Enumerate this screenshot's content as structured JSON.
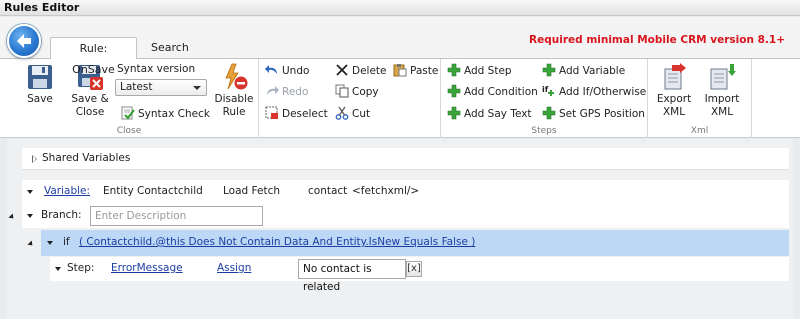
{
  "window": {
    "title": "Rules Editor"
  },
  "tabs": [
    {
      "label": "Rule: OnSave",
      "active": true
    },
    {
      "label": "Search",
      "active": false
    }
  ],
  "notice": {
    "text": "Required minimal Mobile CRM version 8.1+",
    "color": "#d8141c"
  },
  "ribbon": {
    "close_group": {
      "label": "Close",
      "save": "Save",
      "save_close_line1": "Save &",
      "save_close_line2": "Close",
      "syntax_version_label": "Syntax version",
      "syntax_version_value": "Latest",
      "syntax_check": "Syntax Check",
      "disable_rule_line1": "Disable",
      "disable_rule_line2": "Rule"
    },
    "edit_group": {
      "undo": "Undo",
      "redo": "Redo",
      "deselect": "Deselect",
      "delete": "Delete",
      "copy": "Copy",
      "cut": "Cut",
      "paste": "Paste"
    },
    "steps_group": {
      "label": "Steps",
      "add_step": "Add Step",
      "add_condition": "Add Condition",
      "add_say_text": "Add Say Text",
      "add_variable": "Add Variable",
      "add_if_otherwise": "Add If/Otherwise",
      "set_gps_position": "Set GPS Position"
    },
    "xml_group": {
      "label": "Xml",
      "export_line1": "Export",
      "export_line2": "XML",
      "import_line1": "Import",
      "import_line2": "XML"
    }
  },
  "shared_variables": {
    "label": "Shared Variables"
  },
  "tree": {
    "variable": {
      "link": "Variable:",
      "entity": "Entity",
      "entity_name": "Contactchild",
      "load": "Load Fetch",
      "target": "contact",
      "value": "<fetchxml/>"
    },
    "branch": {
      "label": "Branch:",
      "description_placeholder": "Enter Description"
    },
    "if_row": {
      "keyword": "if",
      "condition": "( Contactchild.@this Does Not Contain Data And Entity.IsNew Equals False )"
    },
    "step": {
      "label": "Step:",
      "name": "ErrorMessage",
      "action": "Assign",
      "value": "No contact is related",
      "clear": "[x]"
    }
  }
}
